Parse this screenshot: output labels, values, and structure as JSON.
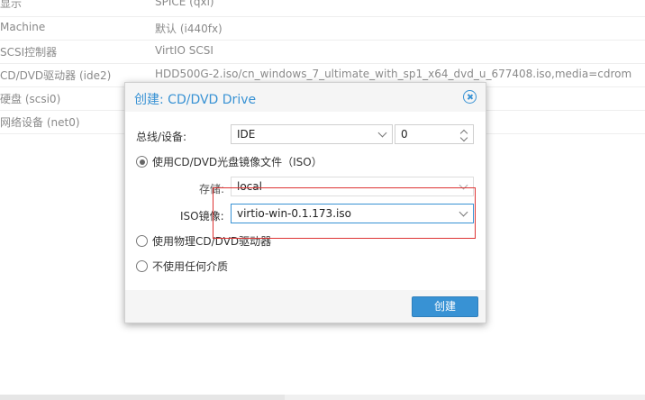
{
  "hardware_list": [
    {
      "key": "显示",
      "value": "SPICE (qxl)"
    },
    {
      "key": "Machine",
      "value": "默认 (i440fx)"
    },
    {
      "key": "SCSI控制器",
      "value": "VirtIO SCSI"
    },
    {
      "key": "CD/DVD驱动器 (ide2)",
      "value": "HDD500G-2.iso/cn_windows_7_ultimate_with_sp1_x64_dvd_u_677408.iso,media=cdrom"
    },
    {
      "key": "硬盘 (scsi0)",
      "value": ""
    },
    {
      "key": "网络设备 (net0)",
      "value": ""
    }
  ],
  "dialog": {
    "title": "创建: CD/DVD Drive",
    "bus_label": "总线/设备:",
    "bus_value": "IDE",
    "device_index": "0",
    "option_iso_label": "使用CD/DVD光盘镜像文件（ISO）",
    "storage_label": "存储:",
    "storage_value": "local",
    "iso_label": "ISO镜像:",
    "iso_value": "virtio-win-0.1.173.iso",
    "option_physical_label": "使用物理CD/DVD驱动器",
    "option_none_label": "不使用任何介质",
    "create_label": "创建"
  },
  "colors": {
    "accent": "#3892d4",
    "annotation": "#dd3333"
  }
}
